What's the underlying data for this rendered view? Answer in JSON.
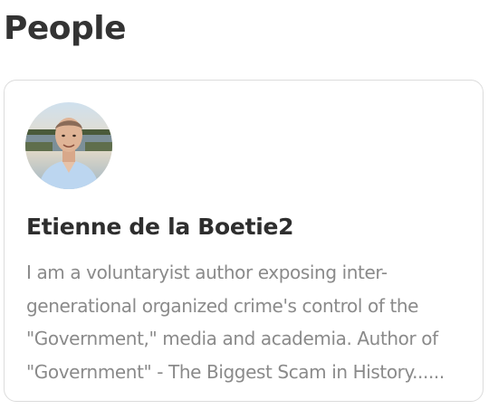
{
  "section": {
    "title": "People"
  },
  "person": {
    "name": "Etienne de la Boetie2",
    "bio_lines": [
      "I am a voluntaryist author exposing inter-",
      "generational organized crime's control of the",
      "\"Government,\" media and academia. Author of",
      "\"Government\" - The Biggest Scam in History......"
    ],
    "avatar_icon": "profile-photo"
  },
  "colors": {
    "title": "#333333",
    "name": "#2e2e2e",
    "bio": "#8a8a8a",
    "card_border": "#dcdcdc"
  }
}
